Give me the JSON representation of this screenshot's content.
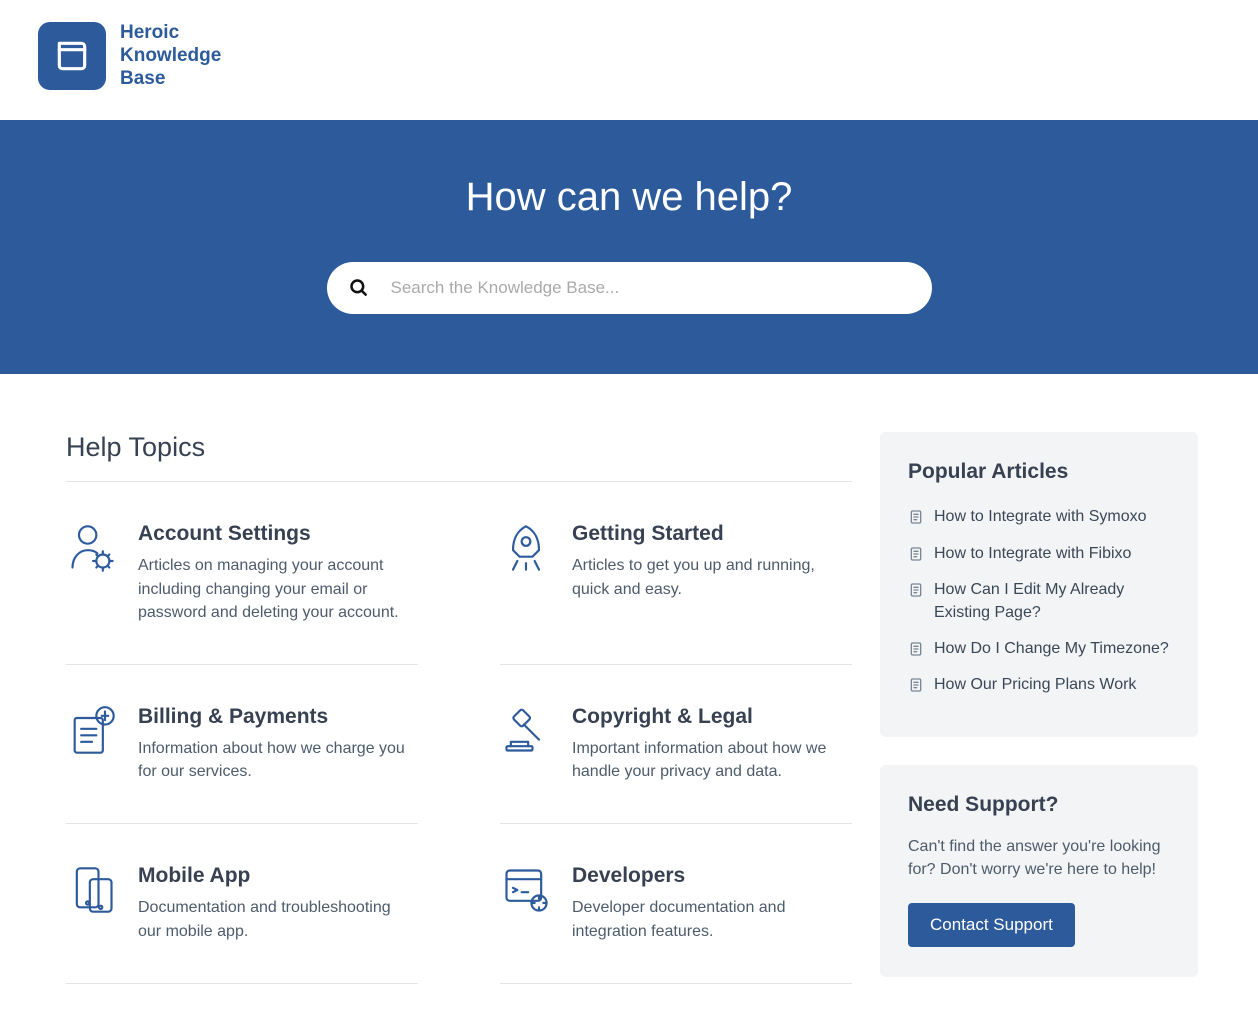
{
  "brand": {
    "name_line1": "Heroic",
    "name_line2": "Knowledge",
    "name_line3": "Base"
  },
  "hero": {
    "title": "How can we help?",
    "search_placeholder": "Search the Knowledge Base..."
  },
  "help_topics": {
    "heading": "Help Topics",
    "items": [
      {
        "title": "Account Settings",
        "desc": "Articles on managing your account including changing your email or password and deleting your account.",
        "icon": "user-gear-icon"
      },
      {
        "title": "Getting Started",
        "desc": "Articles to get you up and running, quick and easy.",
        "icon": "rocket-icon"
      },
      {
        "title": "Billing & Payments",
        "desc": "Information about how we charge you for our services.",
        "icon": "invoice-icon"
      },
      {
        "title": "Copyright & Legal",
        "desc": "Important information about how we handle your privacy and data.",
        "icon": "gavel-icon"
      },
      {
        "title": "Mobile App",
        "desc": "Documentation and troubleshooting our mobile app.",
        "icon": "mobile-icon"
      },
      {
        "title": "Developers",
        "desc": "Developer documentation and integration features.",
        "icon": "dev-window-icon"
      }
    ]
  },
  "sidebar": {
    "popular": {
      "heading": "Popular Articles",
      "items": [
        "How to Integrate with Symoxo",
        "How to Integrate with Fibixo",
        "How Can I Edit My Already Existing Page?",
        "How Do I Change My Timezone?",
        "How Our Pricing Plans Work"
      ]
    },
    "support": {
      "heading": "Need Support?",
      "text": "Can't find the answer you're looking for? Don't worry we're here to help!",
      "button": "Contact Support"
    }
  },
  "colors": {
    "brand": "#2c5a9b",
    "panel_bg": "#f3f4f5",
    "text_muted": "#4d5b6b"
  }
}
